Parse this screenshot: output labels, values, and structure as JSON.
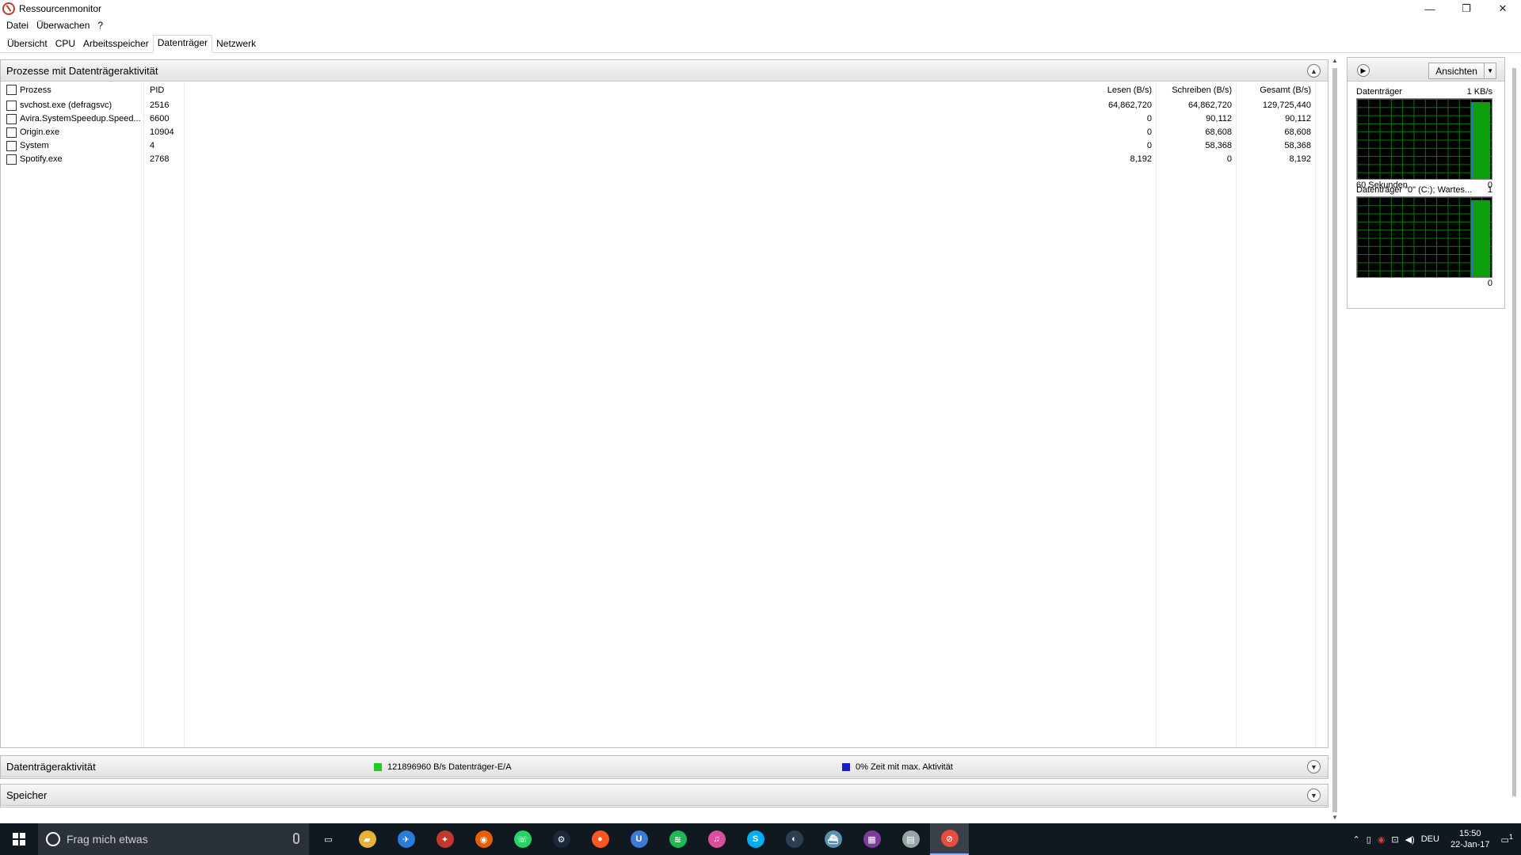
{
  "window": {
    "title": "Ressourcenmonitor",
    "minimize": "—",
    "restore": "❐",
    "close": "✕"
  },
  "menu": [
    "Datei",
    "Überwachen",
    "?"
  ],
  "tabs": [
    "Übersicht",
    "CPU",
    "Arbeitsspeicher",
    "Datenträger",
    "Netzwerk"
  ],
  "active_tab": "Datenträger",
  "processes": {
    "title": "Prozesse mit Datenträgeraktivität",
    "columns": {
      "name": "Prozess",
      "pid": "PID",
      "read": "Lesen (B/s)",
      "write": "Schreiben (B/s)",
      "total": "Gesamt (B/s)"
    },
    "rows": [
      {
        "name": "svchost.exe (defragsvc)",
        "pid": "2516",
        "read": "64,862,720",
        "write": "64,862,720",
        "total": "129,725,440"
      },
      {
        "name": "Avira.SystemSpeedup.Speed...",
        "pid": "6600",
        "read": "0",
        "write": "90,112",
        "total": "90,112"
      },
      {
        "name": "Origin.exe",
        "pid": "10904",
        "read": "0",
        "write": "68,608",
        "total": "68,608"
      },
      {
        "name": "System",
        "pid": "4",
        "read": "0",
        "write": "58,368",
        "total": "58,368"
      },
      {
        "name": "Spotify.exe",
        "pid": "2768",
        "read": "8,192",
        "write": "0",
        "total": "8,192"
      }
    ]
  },
  "activity": {
    "title": "Datenträgeraktivität",
    "io_text": "121896960 B/s Datenträger-E/A",
    "io_color": "#22cc22",
    "max_text": "0% Zeit mit max. Aktivität",
    "max_color": "#1a1acc"
  },
  "storage": {
    "title": "Speicher"
  },
  "right_panel": {
    "view_button": "Ansichten",
    "graph1": {
      "title": "Datenträger",
      "scale": "1 KB/s",
      "footer_left": "60 Sekunden",
      "footer_right": "0"
    },
    "graph2": {
      "title": "Datenträger \"0\" (C:); Wartes...",
      "scale": "1",
      "footer_right": "0"
    }
  },
  "taskbar": {
    "search_placeholder": "Frag mich etwas",
    "language": "DEU",
    "time": "15:50",
    "date": "22-Jan-17",
    "notification_count": "1",
    "apps": [
      {
        "name": "task-view",
        "color": "#101820",
        "glyph": "▭"
      },
      {
        "name": "file-explorer",
        "color": "#e8b23a",
        "glyph": "▰"
      },
      {
        "name": "app-blue",
        "color": "#2b7bd8",
        "glyph": "✈"
      },
      {
        "name": "app-red",
        "color": "#c0392b",
        "glyph": "✦"
      },
      {
        "name": "firefox",
        "color": "#e66000",
        "glyph": "◉"
      },
      {
        "name": "whatsapp",
        "color": "#25d366",
        "glyph": "☏"
      },
      {
        "name": "steam",
        "color": "#1b2838",
        "glyph": "⚙"
      },
      {
        "name": "app-orange",
        "color": "#ff5722",
        "glyph": "●"
      },
      {
        "name": "app-u",
        "color": "#3a7bd5",
        "glyph": "U"
      },
      {
        "name": "spotify",
        "color": "#1db954",
        "glyph": "≋"
      },
      {
        "name": "itunes",
        "color": "#d94fa0",
        "glyph": "♫"
      },
      {
        "name": "skype",
        "color": "#00aff0",
        "glyph": "S"
      },
      {
        "name": "app-dark",
        "color": "#2c3e50",
        "glyph": "◐"
      },
      {
        "name": "app-boat",
        "color": "#5b8fb0",
        "glyph": "⛴"
      },
      {
        "name": "app-color",
        "color": "#7d3c98",
        "glyph": "▦"
      },
      {
        "name": "app-window",
        "color": "#95a5a6",
        "glyph": "▤"
      },
      {
        "name": "resource-monitor",
        "color": "#e74c3c",
        "glyph": "⊘"
      }
    ]
  }
}
